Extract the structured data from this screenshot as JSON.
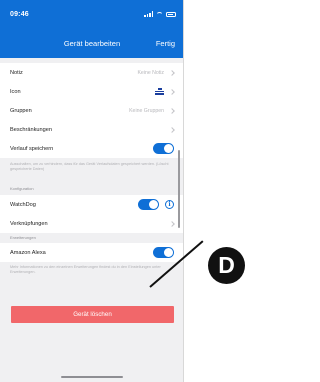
{
  "status_bar": {
    "time": "09:46"
  },
  "nav": {
    "title": "Gerät bearbeiten",
    "done": "Fertig"
  },
  "rows": {
    "notiz": {
      "label": "Notiz",
      "value": "Keine Notiz"
    },
    "icon": {
      "label": "Icon",
      "icon": "device-icon"
    },
    "gruppen": {
      "label": "Gruppen",
      "value": "Keine Gruppen"
    },
    "beschraenkungen": {
      "label": "Beschränkungen"
    },
    "verlauf": {
      "label": "Verlauf speichern",
      "toggle_on": true,
      "footnote": "Ausschalten, um zu verhindern, dass für das Gerät Verlaufsdaten gespeichert werden. (Löscht gespeicherte Daten)"
    },
    "watchdog": {
      "label": "WatchDog",
      "toggle_on": true
    },
    "verknuepfungen": {
      "label": "Verknüpfungen"
    },
    "alexa": {
      "label": "Amazon Alexa",
      "toggle_on": true,
      "footnote": "Mehr Informationen zu den einzelnen Erweiterungen findest du in den Einstellungen unter Erweiterungen."
    }
  },
  "sections": {
    "konfiguration": "Konfiguration",
    "erweiterungen": "Erweiterungen"
  },
  "delete_button": {
    "label": "Gerät löschen",
    "color": "#f1676a"
  },
  "annotation": {
    "label": "D"
  },
  "colors": {
    "accent": "#0f6fd6",
    "background": "#f0f0f2"
  }
}
